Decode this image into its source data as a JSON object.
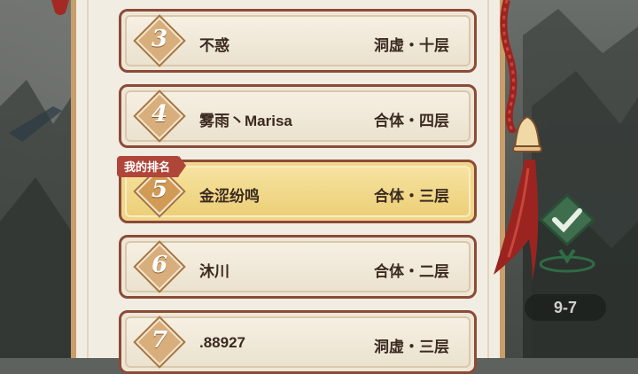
{
  "leaderboard": {
    "rows": [
      {
        "rank": "3",
        "name": "不惑",
        "realm": "洞虚・十层",
        "is_me": false
      },
      {
        "rank": "4",
        "name": "雾雨丶Marisa",
        "realm": "合体・四层",
        "is_me": false
      },
      {
        "rank": "5",
        "name": "金涩纷鸣",
        "realm": "合体・三层",
        "is_me": true
      },
      {
        "rank": "6",
        "name": "沐川",
        "realm": "合体・二层",
        "is_me": false
      },
      {
        "rank": "7",
        "name": ".88927",
        "realm": "洞虚・三层",
        "is_me": false
      }
    ],
    "my_rank_label": "我的排名"
  },
  "stage": {
    "label": "9-7"
  },
  "colors": {
    "row_border": "#8b4b38",
    "highlight": "#f0d68a",
    "accent_red": "#b0453a",
    "rope": "#9b2420"
  },
  "icons": [
    "check-icon",
    "bell-icon",
    "tassel-icon",
    "rank-diamond-icon"
  ]
}
